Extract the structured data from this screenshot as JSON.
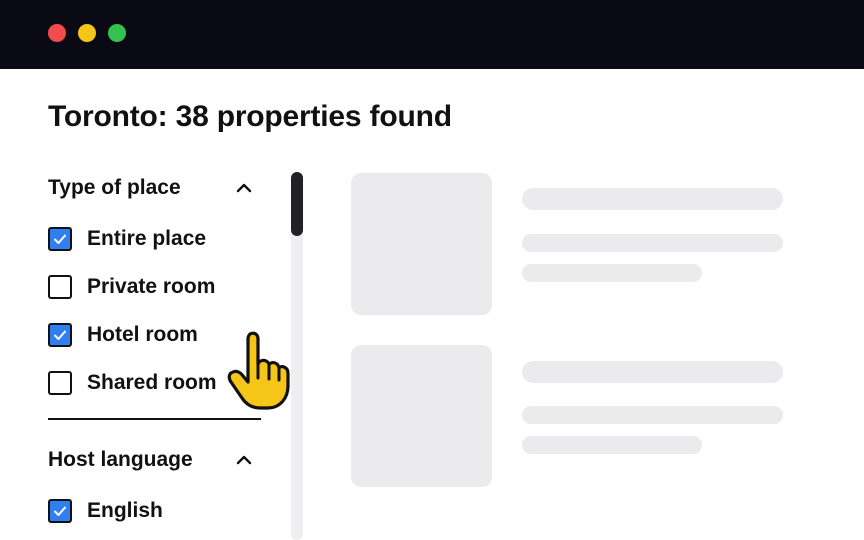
{
  "window": {
    "controls": [
      "close",
      "minimize",
      "maximize"
    ],
    "colors": {
      "close": "#f24b4b",
      "minimize": "#f5c518",
      "maximize": "#33c24d",
      "titlebar": "#0a0a14"
    }
  },
  "page_title": "Toronto: 38 properties found",
  "filters": {
    "type_of_place": {
      "title": "Type of place",
      "expanded": true,
      "icon": "chevron-up-icon",
      "options": [
        {
          "label": "Entire place",
          "checked": true
        },
        {
          "label": "Private room",
          "checked": false
        },
        {
          "label": "Hotel room",
          "checked": true
        },
        {
          "label": "Shared room",
          "checked": false
        }
      ]
    },
    "host_language": {
      "title": "Host language",
      "expanded": true,
      "icon": "chevron-up-icon",
      "options": [
        {
          "label": "English",
          "checked": true
        }
      ]
    }
  },
  "results": {
    "state": "loading",
    "placeholder_cards": 2
  },
  "cursor": {
    "icon": "pointer-hand-icon",
    "color": "#f5c518"
  },
  "accent_color": "#2f7ff0"
}
